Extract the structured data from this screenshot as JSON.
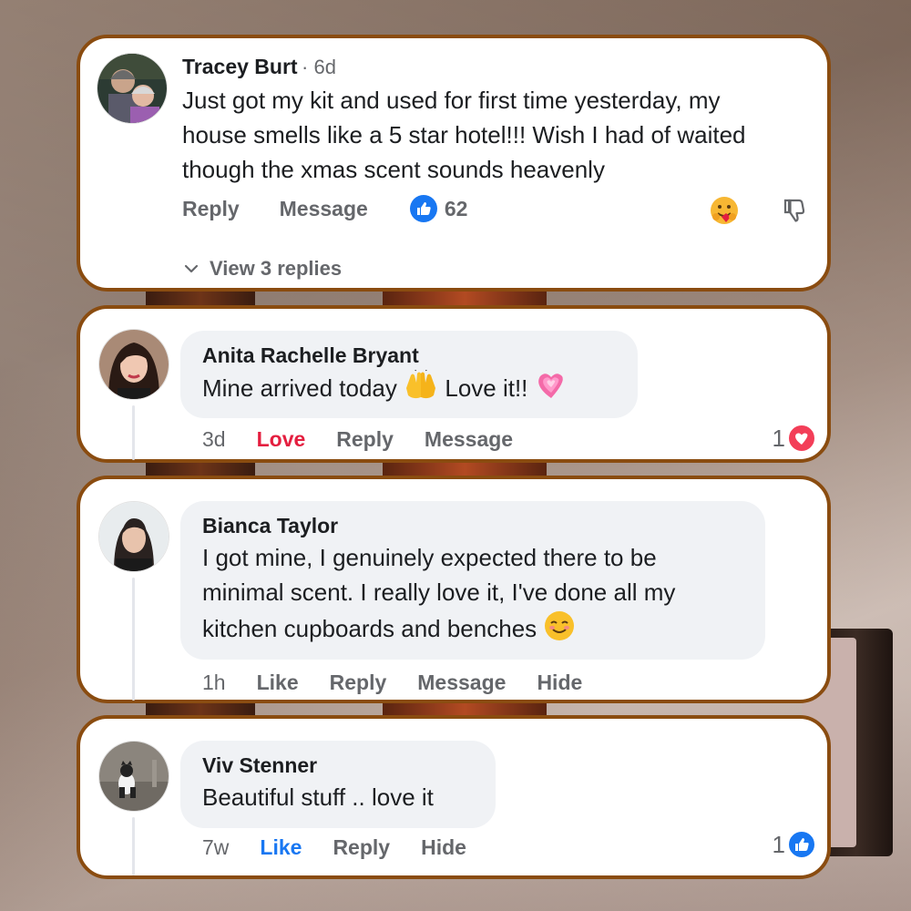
{
  "comments": [
    {
      "name": "Tracey Burt",
      "time": "6d",
      "text_lines": [
        "Just got my kit and used for first time yesterday, my",
        "house smells like a 5 star hotel!!! Wish I had of waited",
        "though the xmas scent sounds heavenly"
      ],
      "actions": [
        "Reply",
        "Message"
      ],
      "reaction_count": "62",
      "view_replies": "View 3 replies"
    },
    {
      "name": "Anita Rachelle Bryant",
      "text_before_emoji": "Mine arrived today",
      "text_after_emoji": "Love it!!",
      "time": "3d",
      "actions": [
        "Love",
        "Reply",
        "Message"
      ],
      "reaction_count": "1"
    },
    {
      "name": "Bianca Taylor",
      "text_lines": [
        "I got mine, I genuinely expected there to be",
        "minimal scent. I really love it, I've done all my",
        "kitchen cupboards and benches"
      ],
      "time": "1h",
      "actions": [
        "Like",
        "Reply",
        "Message",
        "Hide"
      ]
    },
    {
      "name": "Viv Stenner",
      "text": "Beautiful stuff .. love it",
      "time": "7w",
      "actions": [
        "Like",
        "Reply",
        "Hide"
      ],
      "reaction_count": "1"
    }
  ],
  "colors": {
    "card_border": "#8a4c10",
    "like_blue": "#1877f2",
    "love_red": "#e41e3f",
    "bubble_gray": "#f0f2f5",
    "meta_gray": "#65676b"
  },
  "icons": [
    "like-icon",
    "heart-reaction-icon",
    "hugging-emoji-icon",
    "dislike-icon",
    "chevron-down-icon",
    "raised-hands-emoji",
    "growing-heart-emoji",
    "smiling-emoji"
  ]
}
